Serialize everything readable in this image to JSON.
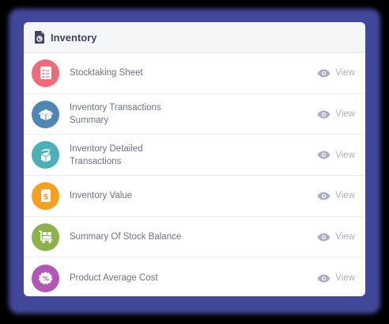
{
  "panel": {
    "title": "Inventory",
    "title_icon": "document-report-icon"
  },
  "items": [
    {
      "label": "Stocktaking Sheet",
      "icon": "checklist-icon",
      "color": "#ef6b77",
      "action": "View"
    },
    {
      "label": "Inventory Transactions Summary",
      "icon": "open-box-icon",
      "color": "#4e86b4",
      "action": "View"
    },
    {
      "label": "Inventory Detailed Transactions",
      "icon": "box-exchange-icon",
      "color": "#4bb1b6",
      "action": "View"
    },
    {
      "label": "Inventory Value",
      "icon": "dollar-tag-icon",
      "color": "#f7a01f",
      "action": "View"
    },
    {
      "label": "Summary Of Stock Balance",
      "icon": "cart-boxes-icon",
      "color": "#8cb24a",
      "action": "View"
    },
    {
      "label": "Product Average Cost",
      "icon": "percent-tag-icon",
      "color": "#b455b8",
      "action": "View"
    }
  ],
  "colors": {
    "frame_glow": "#41489a",
    "header_bg": "#f5f6f8",
    "label_text": "#6c7189",
    "view_text": "#a9aec4"
  }
}
